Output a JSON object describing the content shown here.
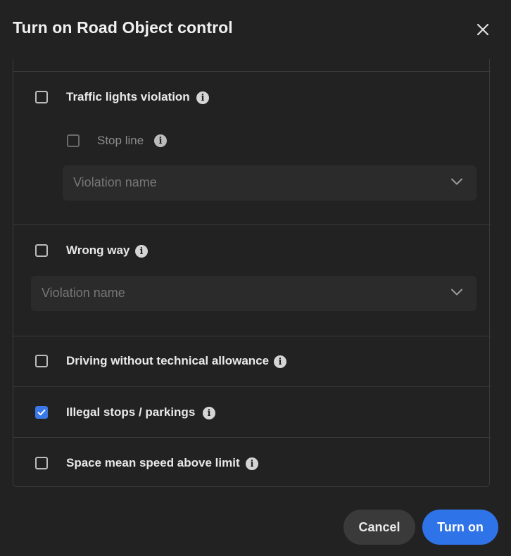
{
  "dialog": {
    "title": "Turn on Road Object control",
    "close_icon": "close-icon"
  },
  "options": {
    "traffic_lights": {
      "label": "Traffic lights violation",
      "checked": false,
      "stop_line": {
        "label": "Stop line",
        "checked": false,
        "disabled": true
      },
      "violation_select": {
        "placeholder": "Violation name"
      }
    },
    "wrong_way": {
      "label": "Wrong way",
      "checked": false,
      "violation_select": {
        "placeholder": "Violation name"
      }
    },
    "technical_allowance": {
      "label": "Driving without technical allowance",
      "checked": false
    },
    "illegal_stops": {
      "label": "Illegal stops / parkings",
      "checked": true
    },
    "space_mean_speed": {
      "label": "Space mean speed above limit",
      "checked": false
    }
  },
  "footer": {
    "cancel_label": "Cancel",
    "turn_on_label": "Turn on"
  },
  "colors": {
    "background": "#222222",
    "accent": "#2f73e8",
    "checkbox_checked": "#3b78e7",
    "divider": "#3a3a3a"
  }
}
